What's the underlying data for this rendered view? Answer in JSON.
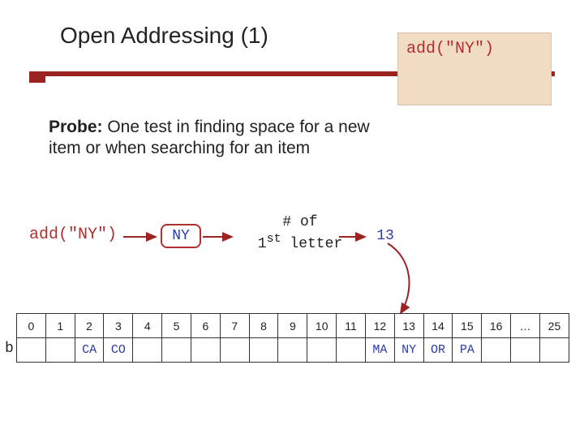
{
  "title": "Open Addressing (1)",
  "call_text": "add(\"NY\")",
  "probe_label": "Probe:",
  "probe_body": " One test in finding space for a new item or when searching for an item",
  "add_label": "add(\"NY\")",
  "ny_box": "NY",
  "hash_line1": "# of",
  "hash_line2": "1st letter",
  "result": "13",
  "array_label": "b",
  "table": {
    "indices": [
      "0",
      "1",
      "2",
      "3",
      "4",
      "5",
      "6",
      "7",
      "8",
      "9",
      "10",
      "11",
      "12",
      "13",
      "14",
      "15",
      "16",
      "…",
      "25"
    ],
    "values": [
      "",
      "",
      "CA",
      "CO",
      "",
      "",
      "",
      "",
      "",
      "",
      "",
      "",
      "MA",
      "NY",
      "OR",
      "PA",
      "",
      "",
      ""
    ]
  },
  "colors": {
    "accent": "#9b2423",
    "code": "#b03030",
    "value": "#2a3aa8",
    "callbox_bg": "#efdcc3"
  }
}
